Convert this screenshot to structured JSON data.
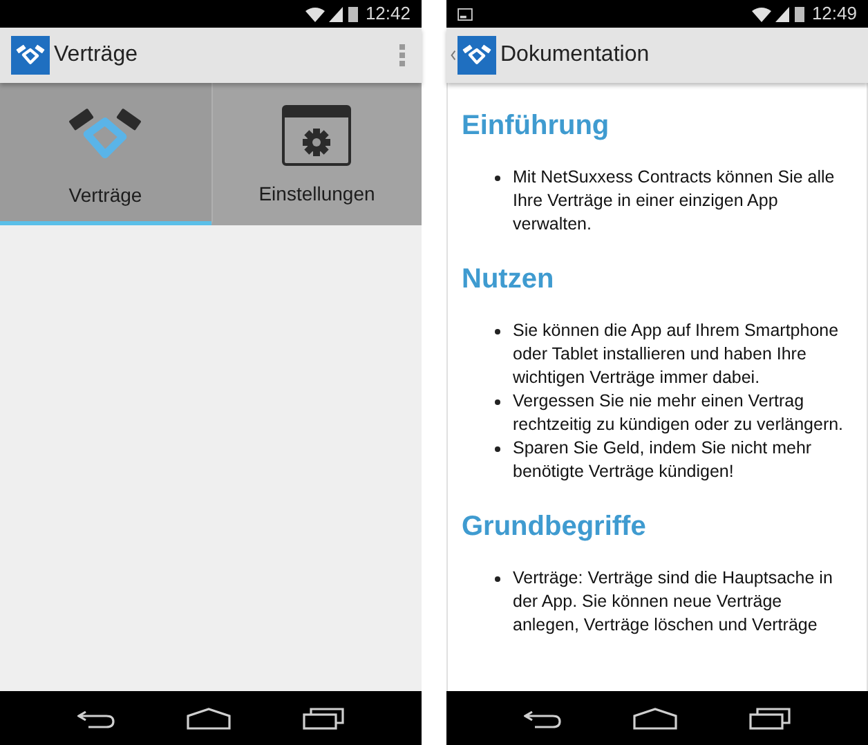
{
  "phones": [
    {
      "kind": "tabs",
      "status_bar": {
        "time": "12:42",
        "notification_icon": false
      },
      "action_bar": {
        "title": "Verträge",
        "up_caret": false,
        "menu": true
      },
      "tabs": [
        {
          "label": "Verträge",
          "selected": true
        },
        {
          "label": "Einstellungen",
          "selected": false
        }
      ]
    },
    {
      "kind": "document",
      "status_bar": {
        "time": "12:49",
        "notification_icon": true
      },
      "action_bar": {
        "title": "Dokumentation",
        "up_caret": true,
        "menu": false
      },
      "sections": [
        {
          "heading": "Einführung",
          "bullets": [
            "Mit NetSuxxess Contracts können Sie alle Ihre Verträge in einer einzigen App verwalten."
          ]
        },
        {
          "heading": "Nutzen",
          "bullets": [
            "Sie können die App auf Ihrem Smartphone oder Tablet installieren und haben Ihre wichtigen Verträge immer dabei.",
            "Vergessen Sie nie mehr einen Vertrag rechtzeitig zu kündigen oder zu verlängern.",
            "Sparen Sie Geld, indem Sie nicht mehr benötigte Verträge kündigen!"
          ]
        },
        {
          "heading": "Grundbegriffe",
          "bullets": [
            "Verträge: Verträge sind die Hauptsache in der App. Sie können neue Verträge anlegen, Verträge löschen und Verträge"
          ]
        }
      ]
    }
  ]
}
